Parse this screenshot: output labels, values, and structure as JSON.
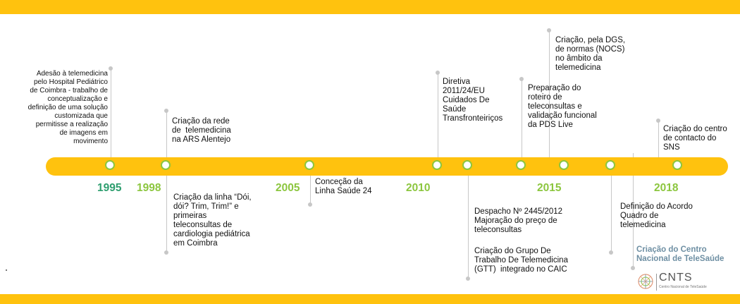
{
  "colors": {
    "band": "#FFC20E",
    "year_green": "#8CC63F",
    "year_teal": "#2E9E6F",
    "stem": "#c7c7c7",
    "cnts_blue": "#6E8FA3"
  },
  "years": {
    "y1995": "1995",
    "y1998": "1998",
    "y2005": "2005",
    "y2010": "2010",
    "y2015": "2015",
    "y2018": "2018"
  },
  "events": {
    "e1995": "Adesão à telemedicina\npelo Hospital Pediátrico\nde Coimbra - trabalho de\nconceptualização e\ndefinição de uma solução\ncustomizada que\npermitisse a realização\nde imagens em\nmovimento",
    "e1998_rede": "Criação da rede\nde  telemedicina\nna ARS Alentejo",
    "e1998_linha": "Criação da linha “Dói,\ndói? Trim, Trim!” e\nprimeiras\nteleconsultas de\ncardiologia pediátrica\nem Coimbra",
    "e2005": "Conceção da\nLinha Saúde 24",
    "e2010_diretiva": "Diretiva\n2011/24/EU\nCuidados De\nSaúde\nTransfronteiriços",
    "e2012_despacho": "Despacho Nº 2445/2012\nMajoração do preço de\nteleconsultas",
    "e_gtt": "Criação do Grupo De\nTrabalho De Telemedicina\n(GTT)  integrado no CAIC",
    "e_pds": "Preparação do\nroteiro de\nteleconsultas e\nvalidação funcional\nda PDS Live",
    "e_dgs": "Criação, pela DGS,\nde normas (NOCS)\nno âmbito da\ntelemedicina",
    "e_acordo": "Definição do Acordo\nQuadro de\ntelemedicina",
    "e_cnts": "Criação do Centro\nNacional de TeleSaúde",
    "e2018_contacto": "Criação do centro\nde contacto do\nSNS"
  },
  "logo": {
    "title": "CNTS",
    "subtitle": "Centro Nacional de TeleSaúde",
    "icon": "globe-network-icon"
  }
}
